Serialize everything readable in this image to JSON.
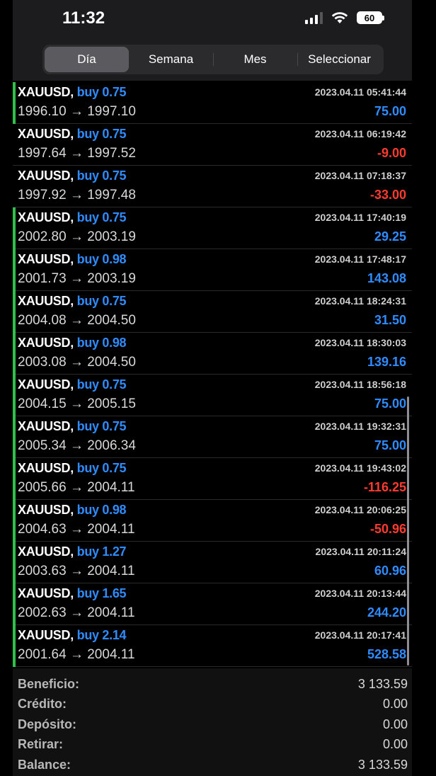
{
  "status_bar": {
    "time": "11:32",
    "battery": "60"
  },
  "tabs": [
    {
      "label": "Día",
      "active": true
    },
    {
      "label": "Semana",
      "active": false
    },
    {
      "label": "Mes",
      "active": false
    },
    {
      "label": "Seleccionar",
      "active": false
    }
  ],
  "trades": [
    {
      "symbol": "XAUUSD,",
      "action": "buy 0.75",
      "prices": "1996.10 → 1997.10",
      "time": "2023.04.11 05:41:44",
      "profit": "75.00",
      "positive": true,
      "bar": true
    },
    {
      "symbol": "XAUUSD,",
      "action": "buy 0.75",
      "prices": "1997.64 → 1997.52",
      "time": "2023.04.11 06:19:42",
      "profit": "-9.00",
      "positive": false,
      "bar": false
    },
    {
      "symbol": "XAUUSD,",
      "action": "buy 0.75",
      "prices": "1997.92 → 1997.48",
      "time": "2023.04.11 07:18:37",
      "profit": "-33.00",
      "positive": false,
      "bar": false
    },
    {
      "symbol": "XAUUSD,",
      "action": "buy 0.75",
      "prices": "2002.80 → 2003.19",
      "time": "2023.04.11 17:40:19",
      "profit": "29.25",
      "positive": true,
      "bar": true
    },
    {
      "symbol": "XAUUSD,",
      "action": "buy 0.98",
      "prices": "2001.73 → 2003.19",
      "time": "2023.04.11 17:48:17",
      "profit": "143.08",
      "positive": true,
      "bar": true
    },
    {
      "symbol": "XAUUSD,",
      "action": "buy 0.75",
      "prices": "2004.08 → 2004.50",
      "time": "2023.04.11 18:24:31",
      "profit": "31.50",
      "positive": true,
      "bar": true
    },
    {
      "symbol": "XAUUSD,",
      "action": "buy 0.98",
      "prices": "2003.08 → 2004.50",
      "time": "2023.04.11 18:30:03",
      "profit": "139.16",
      "positive": true,
      "bar": true
    },
    {
      "symbol": "XAUUSD,",
      "action": "buy 0.75",
      "prices": "2004.15 → 2005.15",
      "time": "2023.04.11 18:56:18",
      "profit": "75.00",
      "positive": true,
      "bar": true
    },
    {
      "symbol": "XAUUSD,",
      "action": "buy 0.75",
      "prices": "2005.34 → 2006.34",
      "time": "2023.04.11 19:32:31",
      "profit": "75.00",
      "positive": true,
      "bar": true
    },
    {
      "symbol": "XAUUSD,",
      "action": "buy 0.75",
      "prices": "2005.66 → 2004.11",
      "time": "2023.04.11 19:43:02",
      "profit": "-116.25",
      "positive": false,
      "bar": true
    },
    {
      "symbol": "XAUUSD,",
      "action": "buy 0.98",
      "prices": "2004.63 → 2004.11",
      "time": "2023.04.11 20:06:25",
      "profit": "-50.96",
      "positive": false,
      "bar": true
    },
    {
      "symbol": "XAUUSD,",
      "action": "buy 1.27",
      "prices": "2003.63 → 2004.11",
      "time": "2023.04.11 20:11:24",
      "profit": "60.96",
      "positive": true,
      "bar": true
    },
    {
      "symbol": "XAUUSD,",
      "action": "buy 1.65",
      "prices": "2002.63 → 2004.11",
      "time": "2023.04.11 20:13:44",
      "profit": "244.20",
      "positive": true,
      "bar": true
    },
    {
      "symbol": "XAUUSD,",
      "action": "buy 2.14",
      "prices": "2001.64 → 2004.11",
      "time": "2023.04.11 20:17:41",
      "profit": "528.58",
      "positive": true,
      "bar": true
    }
  ],
  "summary": [
    {
      "label": "Beneficio:",
      "value": "3 133.59"
    },
    {
      "label": "Crédito:",
      "value": "0.00"
    },
    {
      "label": "Depósito:",
      "value": "0.00"
    },
    {
      "label": "Retirar:",
      "value": "0.00"
    },
    {
      "label": "Balance:",
      "value": "3 133.59"
    }
  ],
  "colors": {
    "buy_blue": "#2f8cff",
    "loss_red": "#ff3b30",
    "indicator_green": "#2fbf4a"
  }
}
